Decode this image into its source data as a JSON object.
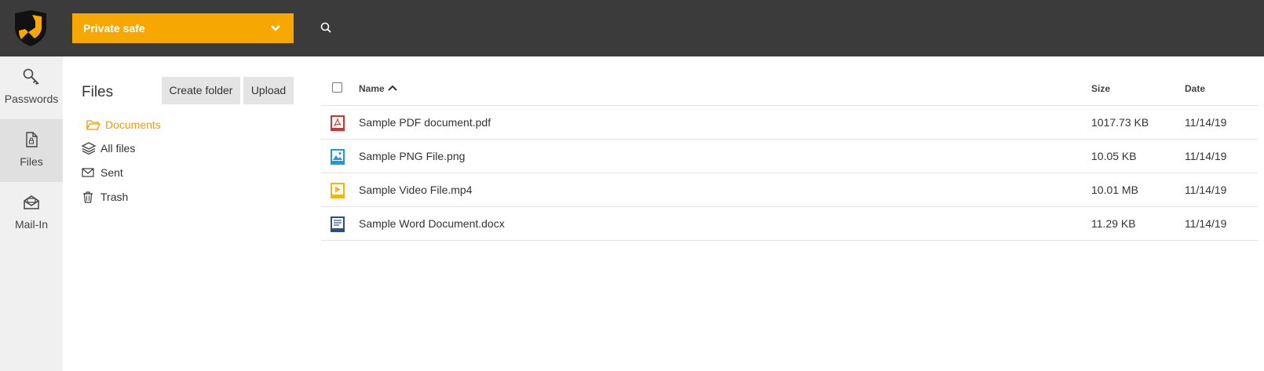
{
  "topbar": {
    "safe_selector": "Private safe"
  },
  "sidenav": [
    {
      "label": "Passwords",
      "icon": "key-icon"
    },
    {
      "label": "Files",
      "icon": "file-icon"
    },
    {
      "label": "Mail-In",
      "icon": "mail-inbox-icon"
    }
  ],
  "files_panel": {
    "title": "Files",
    "create_folder": "Create folder",
    "upload": "Upload",
    "folders": [
      {
        "label": "Documents",
        "icon": "folder-open-icon",
        "active": true
      },
      {
        "label": "All files",
        "icon": "layers-icon"
      },
      {
        "label": "Sent",
        "icon": "envelope-icon"
      },
      {
        "label": "Trash",
        "icon": "trash-icon"
      }
    ]
  },
  "table": {
    "columns": {
      "name": "Name",
      "size": "Size",
      "date": "Date"
    },
    "rows": [
      {
        "name": "Sample PDF document.pdf",
        "size": "1017.73 KB",
        "date": "11/14/19",
        "icon": "pdf-icon"
      },
      {
        "name": "Sample PNG File.png",
        "size": "10.05 KB",
        "date": "11/14/19",
        "icon": "image-icon"
      },
      {
        "name": "Sample Video File.mp4",
        "size": "10.01 MB",
        "date": "11/14/19",
        "icon": "video-icon"
      },
      {
        "name": "Sample Word Document.docx",
        "size": "11.29 KB",
        "date": "11/14/19",
        "icon": "word-icon"
      }
    ]
  },
  "colors": {
    "accent": "#f7a800",
    "topbar": "#3b3b3b",
    "pdf": "#d9312b",
    "image": "#1e9be0",
    "video": "#f3b417",
    "word": "#2a4f8f"
  }
}
